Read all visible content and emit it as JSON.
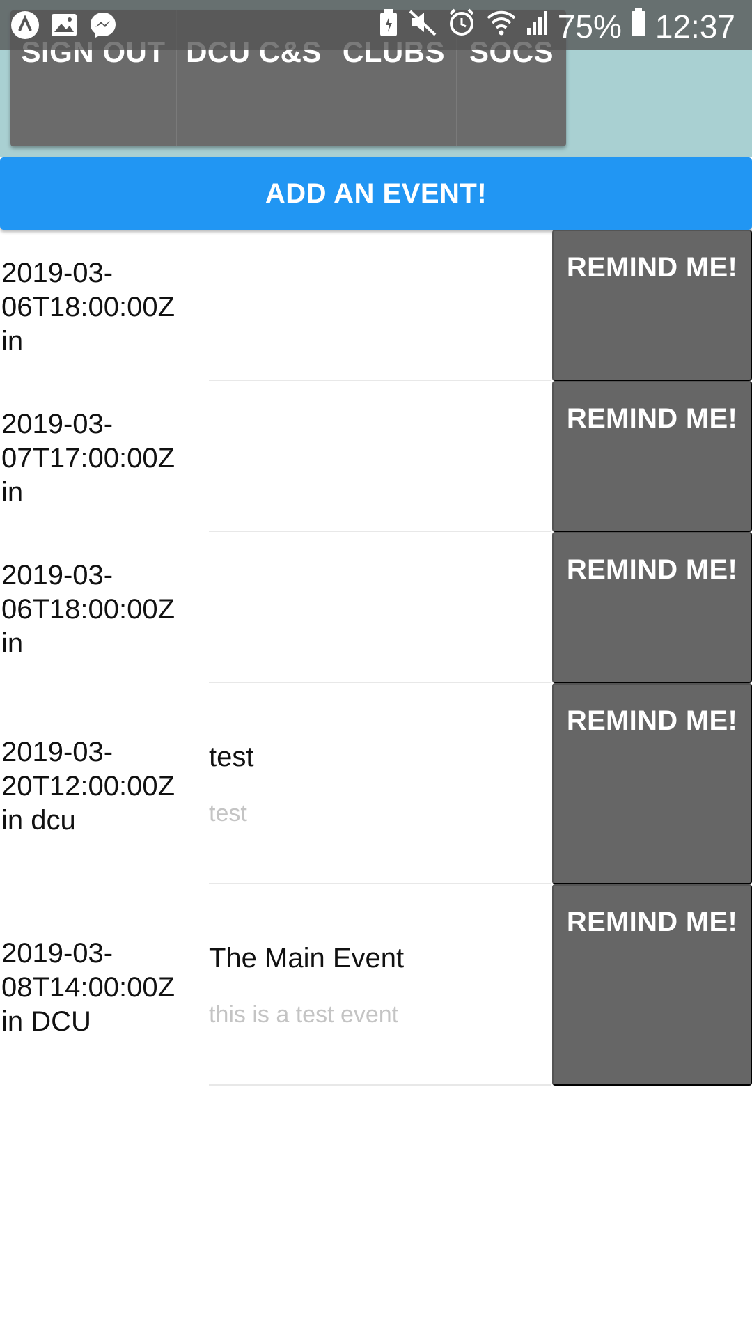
{
  "status_bar": {
    "left_icons": [
      "app-icon",
      "gallery-icon",
      "messenger-icon"
    ],
    "right_icons": [
      "battery-saver-icon",
      "mute-icon",
      "alarm-icon",
      "wifi-icon",
      "signal-icon"
    ],
    "battery": "75%",
    "time": "12:37"
  },
  "nav": {
    "tabs": [
      {
        "label": "SIGN OUT"
      },
      {
        "label": "DCU C&S"
      },
      {
        "label": "CLUBS"
      },
      {
        "label": "SOCS"
      }
    ]
  },
  "add_event_label": "ADD AN EVENT!",
  "events": [
    {
      "date": "2019-03-06T18:00:00Z",
      "location_line": "in",
      "name": "",
      "description": "",
      "remind_label": "REMIND ME!"
    },
    {
      "date": "2019-03-07T17:00:00Z",
      "location_line": "in",
      "name": "",
      "description": "",
      "remind_label": "REMIND ME!"
    },
    {
      "date": "2019-03-06T18:00:00Z",
      "location_line": "in",
      "name": "",
      "description": "",
      "remind_label": "REMIND ME!"
    },
    {
      "date": "2019-03-20T12:00:00Z",
      "location_line": "in dcu",
      "name": "test",
      "description": "test",
      "remind_label": "REMIND ME!"
    },
    {
      "date": "2019-03-08T14:00:00Z",
      "location_line": "in DCU",
      "name": "The Main Event",
      "description": "this is a test event",
      "remind_label": "REMIND ME!"
    }
  ],
  "colors": {
    "status_bar": "#555555",
    "header_bg": "#a9d0d2",
    "nav_bg": "#6b6b6b",
    "primary": "#2196f3",
    "remind_button": "#666666",
    "description_text": "#c4c4c4"
  }
}
